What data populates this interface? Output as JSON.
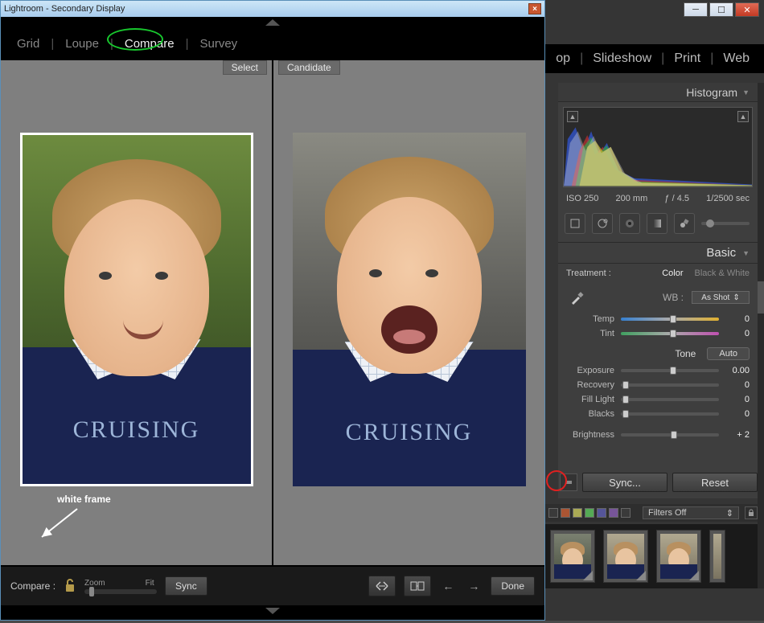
{
  "secondary": {
    "title": "Lightroom - Secondary Display",
    "modes": {
      "grid": "Grid",
      "loupe": "Loupe",
      "compare": "Compare",
      "survey": "Survey"
    },
    "panes": {
      "select": "Select",
      "candidate": "Candidate"
    },
    "shirt_text": "CRUISING",
    "annotation": "white frame",
    "toolbar": {
      "label": "Compare :",
      "zoom_min": "Zoom",
      "zoom_max": "Fit",
      "sync": "Sync",
      "done": "Done",
      "swap_tooltip": "Swap",
      "make_select_tooltip": "Make Select",
      "prev": "←",
      "next": "→"
    }
  },
  "main": {
    "modules": {
      "develop_suffix": "op",
      "slideshow": "Slideshow",
      "print": "Print",
      "web": "Web"
    },
    "histogram": {
      "title": "Histogram",
      "iso": "ISO 250",
      "focal": "200 mm",
      "aperture": "ƒ / 4.5",
      "shutter": "1/2500 sec"
    },
    "basic": {
      "title": "Basic",
      "treatment_label": "Treatment :",
      "color": "Color",
      "bw": "Black & White",
      "wb_label": "WB :",
      "wb_value": "As Shot",
      "temp_label": "Temp",
      "temp_value": "0",
      "tint_label": "Tint",
      "tint_value": "0",
      "tone_label": "Tone",
      "auto": "Auto",
      "exposure_label": "Exposure",
      "exposure_value": "0.00",
      "recovery_label": "Recovery",
      "recovery_value": "0",
      "filllight_label": "Fill Light",
      "filllight_value": "0",
      "blacks_label": "Blacks",
      "blacks_value": "0",
      "brightness_label": "Brightness",
      "brightness_value": "+ 2"
    },
    "actions": {
      "sync": "Sync...",
      "reset": "Reset"
    },
    "filters": {
      "label": "Filters Off"
    }
  }
}
